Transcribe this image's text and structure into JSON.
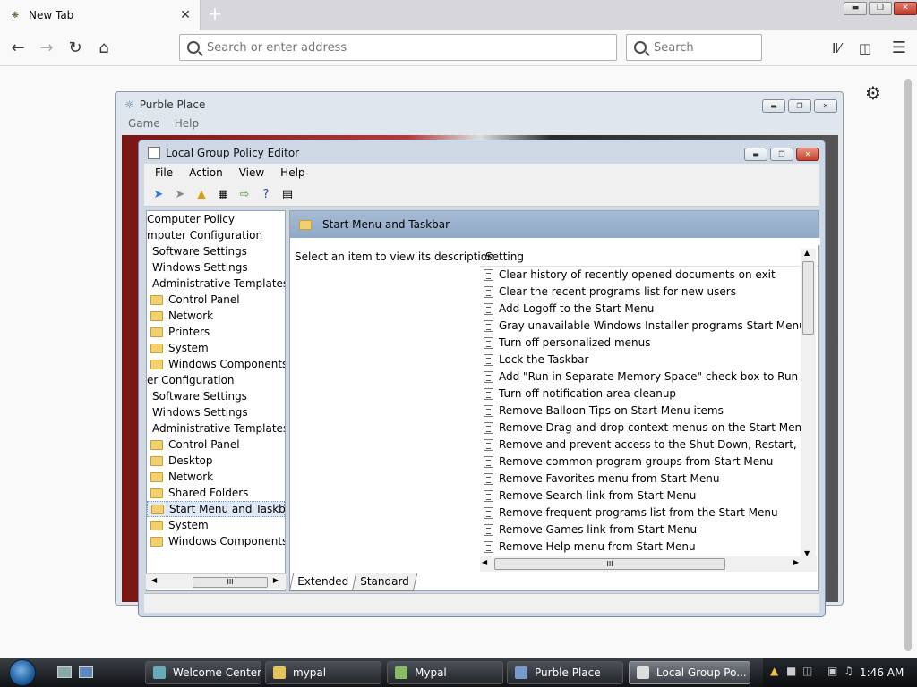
{
  "browser": {
    "tab_title": "New Tab",
    "url_placeholder": "Search or enter address",
    "search_placeholder": "Search"
  },
  "purble": {
    "title": "Purble Place",
    "menu": [
      "Game",
      "Help"
    ]
  },
  "gpe": {
    "title": "Local Group Policy Editor",
    "menu": [
      "File",
      "Action",
      "View",
      "Help"
    ],
    "tree": [
      {
        "label": "Computer Policy",
        "indent": 0,
        "folder": false
      },
      {
        "label": "mputer Configuration",
        "indent": 0,
        "folder": false
      },
      {
        "label": "Software Settings",
        "indent": 1,
        "folder": false
      },
      {
        "label": "Windows Settings",
        "indent": 1,
        "folder": false
      },
      {
        "label": "Administrative Templates",
        "indent": 1,
        "folder": false
      },
      {
        "label": "Control Panel",
        "indent": 2,
        "folder": true
      },
      {
        "label": "Network",
        "indent": 2,
        "folder": true
      },
      {
        "label": "Printers",
        "indent": 2,
        "folder": true
      },
      {
        "label": "System",
        "indent": 2,
        "folder": true
      },
      {
        "label": "Windows Components",
        "indent": 2,
        "folder": true
      },
      {
        "label": "er Configuration",
        "indent": 0,
        "folder": false
      },
      {
        "label": "Software Settings",
        "indent": 1,
        "folder": false
      },
      {
        "label": "Windows Settings",
        "indent": 1,
        "folder": false
      },
      {
        "label": "Administrative Templates",
        "indent": 1,
        "folder": false
      },
      {
        "label": "Control Panel",
        "indent": 2,
        "folder": true
      },
      {
        "label": "Desktop",
        "indent": 2,
        "folder": true
      },
      {
        "label": "Network",
        "indent": 2,
        "folder": true
      },
      {
        "label": "Shared Folders",
        "indent": 2,
        "folder": true
      },
      {
        "label": "Start Menu and Taskbar",
        "indent": 2,
        "folder": true,
        "selected": true
      },
      {
        "label": "System",
        "indent": 2,
        "folder": true
      },
      {
        "label": "Windows Components",
        "indent": 2,
        "folder": true
      }
    ],
    "header": "Start Menu and Taskbar",
    "description": "Select an item to view its description.",
    "column": "Setting",
    "settings": [
      "Clear history of recently opened documents on exit",
      "Clear the recent programs list for new users",
      "Add Logoff to the Start Menu",
      "Gray unavailable Windows Installer programs Start Menu sh...",
      "Turn off personalized menus",
      "Lock the Taskbar",
      "Add \"Run in Separate Memory Space\" check box to Run dial...",
      "Turn off notification area cleanup",
      "Remove Balloon Tips on Start Menu items",
      "Remove Drag-and-drop context menus on the Start Menu",
      "Remove and prevent access to the Shut Down, Restart, Sleep...",
      "Remove common program groups from Start Menu",
      "Remove Favorites menu from Start Menu",
      "Remove Search link from Start Menu",
      "Remove frequent programs list from the Start Menu",
      "Remove Games link from Start Menu",
      "Remove Help menu from Start Menu"
    ],
    "tabs": [
      "Extended",
      "Standard"
    ]
  },
  "taskbar": {
    "buttons": [
      "Welcome Center",
      "mypal",
      "Mypal",
      "Purble Place",
      "Local Group Po..."
    ],
    "clock": "1:46 AM"
  }
}
